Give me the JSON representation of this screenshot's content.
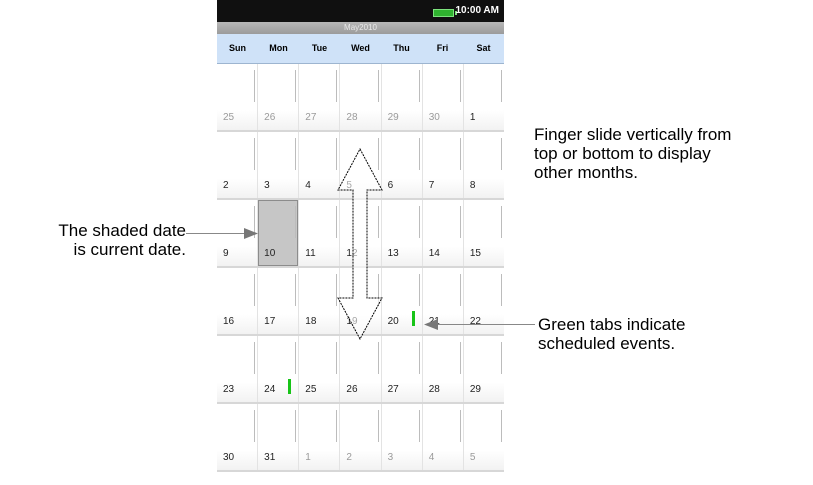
{
  "status": {
    "time": "10:00 AM"
  },
  "calendar": {
    "month_label": "May2010",
    "days_of_week": [
      "Sun",
      "Mon",
      "Tue",
      "Wed",
      "Thu",
      "Fri",
      "Sat"
    ],
    "weeks": [
      [
        {
          "d": "25",
          "other": true
        },
        {
          "d": "26",
          "other": true
        },
        {
          "d": "27",
          "other": true
        },
        {
          "d": "28",
          "other": true
        },
        {
          "d": "29",
          "other": true
        },
        {
          "d": "30",
          "other": true
        },
        {
          "d": "1"
        }
      ],
      [
        {
          "d": "2"
        },
        {
          "d": "3"
        },
        {
          "d": "4"
        },
        {
          "d": "5"
        },
        {
          "d": "6"
        },
        {
          "d": "7"
        },
        {
          "d": "8"
        }
      ],
      [
        {
          "d": "9"
        },
        {
          "d": "10",
          "today": true
        },
        {
          "d": "11"
        },
        {
          "d": "12"
        },
        {
          "d": "13"
        },
        {
          "d": "14"
        },
        {
          "d": "15"
        }
      ],
      [
        {
          "d": "16"
        },
        {
          "d": "17"
        },
        {
          "d": "18"
        },
        {
          "d": "19"
        },
        {
          "d": "20",
          "event": true
        },
        {
          "d": "21"
        },
        {
          "d": "22"
        }
      ],
      [
        {
          "d": "23"
        },
        {
          "d": "24",
          "event": true
        },
        {
          "d": "25"
        },
        {
          "d": "26"
        },
        {
          "d": "27"
        },
        {
          "d": "28"
        },
        {
          "d": "29"
        }
      ],
      [
        {
          "d": "30"
        },
        {
          "d": "31"
        },
        {
          "d": "1",
          "other": true
        },
        {
          "d": "2",
          "other": true
        },
        {
          "d": "3",
          "other": true
        },
        {
          "d": "4",
          "other": true
        },
        {
          "d": "5",
          "other": true
        }
      ]
    ]
  },
  "callouts": {
    "swipe_line1": "Finger slide vertically from",
    "swipe_line2": "top or bottom to display",
    "swipe_line3": "other months.",
    "shaded_line1": "The shaded date",
    "shaded_line2": "is current date.",
    "green_line1": "Green tabs indicate",
    "green_line2": "scheduled events."
  },
  "colors": {
    "event_tab": "#18c418",
    "header_bg": "#cfe2f8",
    "today_bg": "#c6c6c6"
  },
  "icons": [
    "battery-icon",
    "double-arrow-icon"
  ]
}
